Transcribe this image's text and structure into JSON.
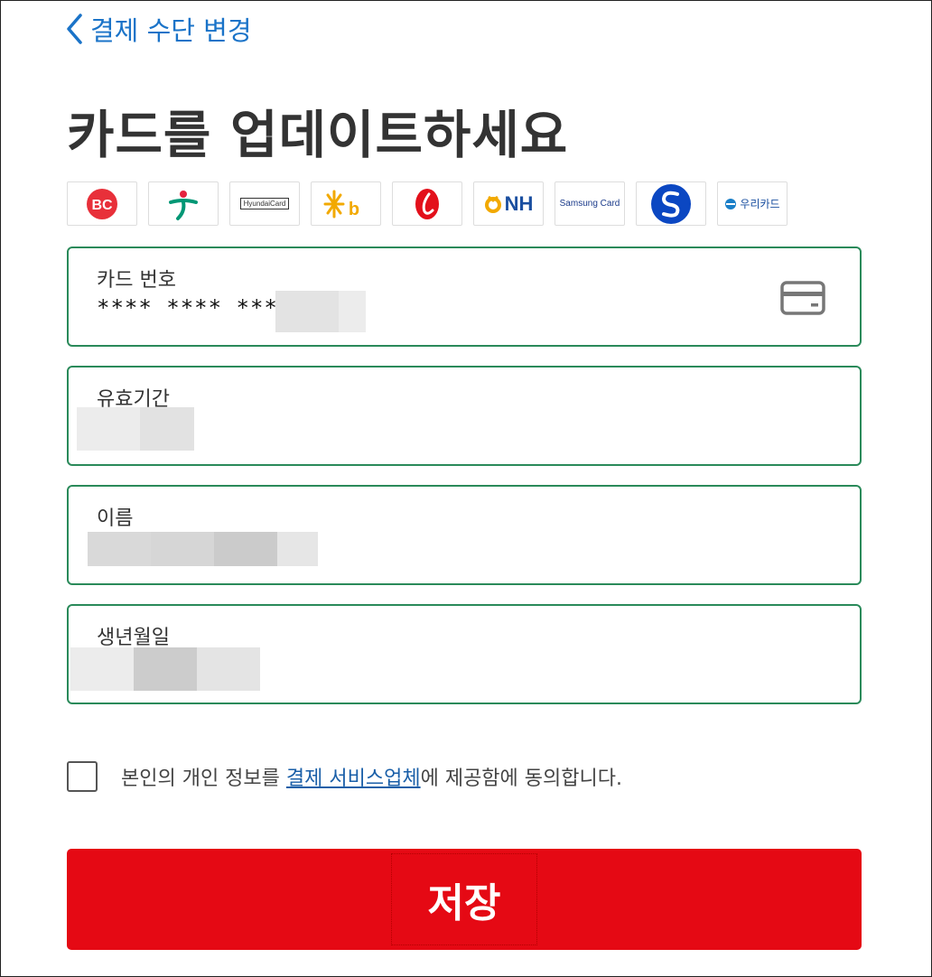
{
  "header": {
    "back_label": "결제 수단 변경",
    "title": "카드를 업데이트하세요"
  },
  "card_logos": [
    {
      "name": "bc-card",
      "text": "BC"
    },
    {
      "name": "hana-card",
      "text": ""
    },
    {
      "name": "hyundai-card",
      "text": "HyundaiCard"
    },
    {
      "name": "kb-card",
      "text": "Kb"
    },
    {
      "name": "lotte-card",
      "text": ""
    },
    {
      "name": "nh-card",
      "text": "NH"
    },
    {
      "name": "samsung-card",
      "text": "Samsung Card"
    },
    {
      "name": "shinhan-card",
      "text": ""
    },
    {
      "name": "woori-card",
      "text": "우리카드"
    }
  ],
  "form": {
    "card_number": {
      "label": "카드 번호",
      "value": "**** **** ****"
    },
    "expiry": {
      "label": "유효기간"
    },
    "name": {
      "label": "이름"
    },
    "birthdate": {
      "label": "생년월일"
    }
  },
  "consent": {
    "prefix": "본인의 개인 정보를 ",
    "link": "결제 서비스업체",
    "suffix": "에 제공함에 동의합니다."
  },
  "actions": {
    "save_label": "저장"
  },
  "colors": {
    "accent_link": "#1a73c8",
    "field_border": "#2a8a5a",
    "save_button": "#e50914"
  }
}
